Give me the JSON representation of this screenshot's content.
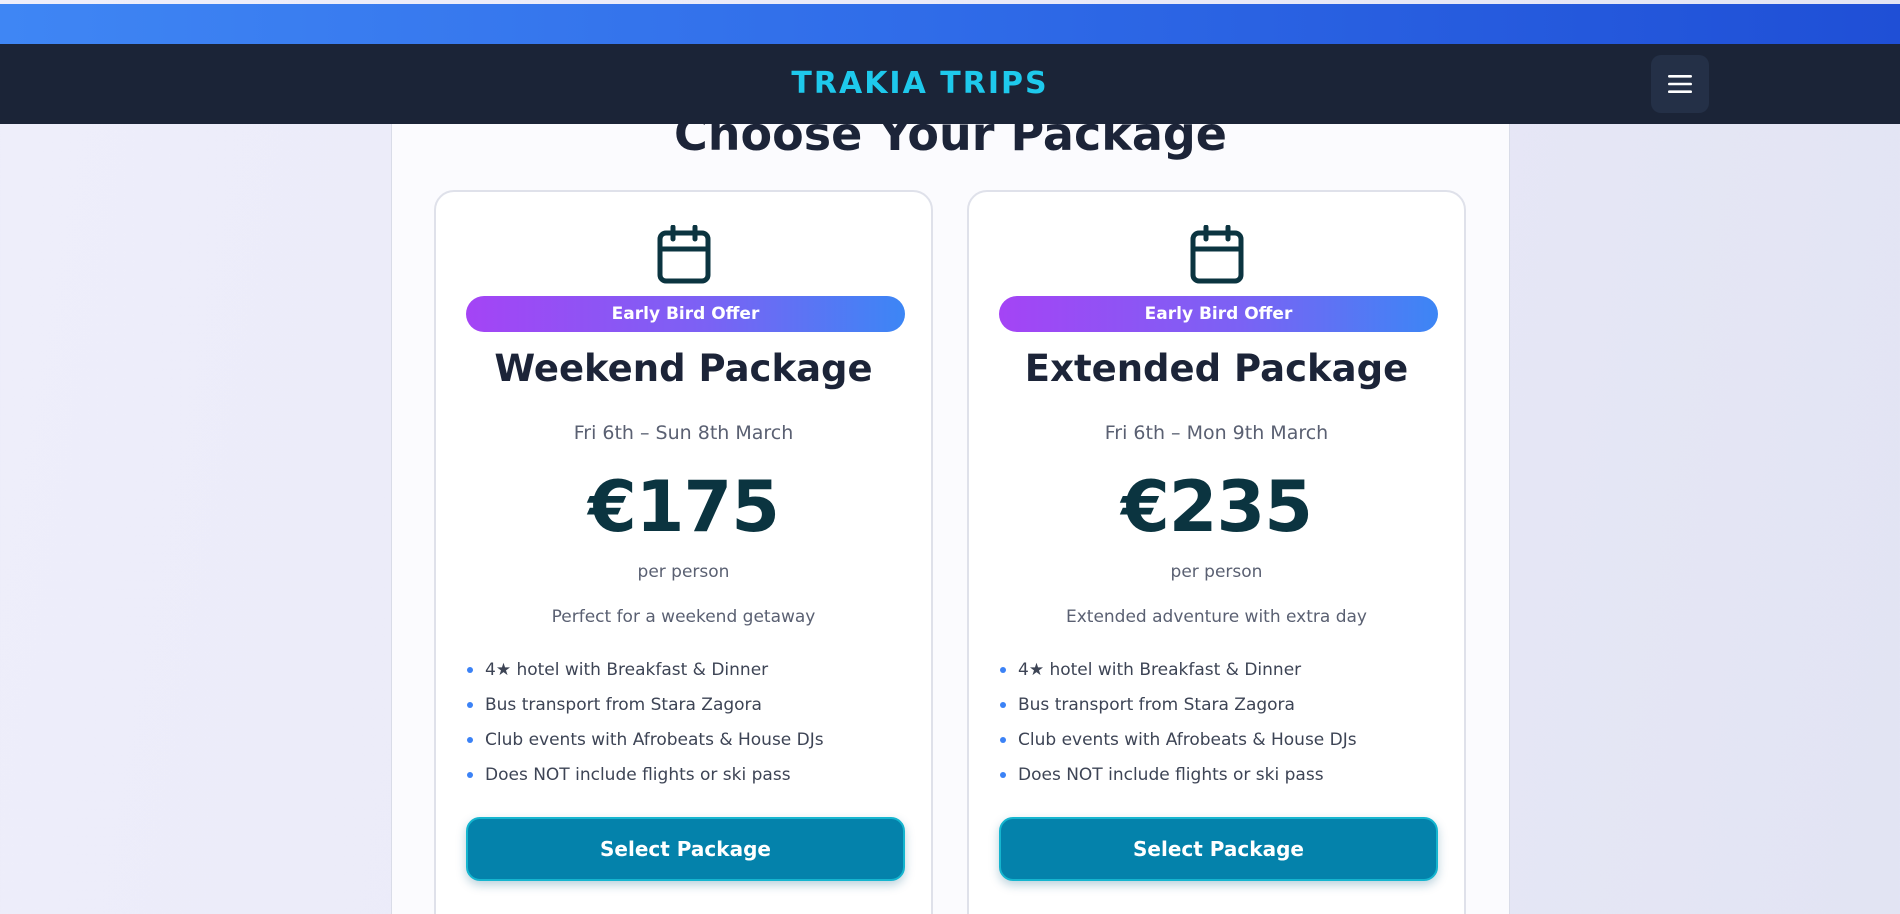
{
  "brand": {
    "name": "TRAKIA TRIPS"
  },
  "menu": {
    "icon": "hamburger-menu-icon"
  },
  "section": {
    "title": "Choose Your Package"
  },
  "colors": {
    "brand_accent": "#1ec9ec",
    "nav_background": "#1b2437",
    "badge_gradient_start": "#a444f5",
    "badge_gradient_end": "#3c86f5",
    "price_text": "#0b3440",
    "button_background": "#0482ab",
    "bullet": "#3b82f6"
  },
  "packages": [
    {
      "icon": "calendar-icon",
      "badge": "Early Bird Offer",
      "title": "Weekend Package",
      "dates": "Fri 6th – Sun 8th March",
      "price": "€175",
      "price_unit": "per person",
      "tagline": "Perfect for a weekend getaway",
      "features": [
        "4★ hotel with Breakfast & Dinner",
        "Bus transport from Stara Zagora",
        "Club events with Afrobeats & House DJs",
        "Does NOT include flights or ski pass"
      ],
      "button": "Select Package"
    },
    {
      "icon": "calendar-icon",
      "badge": "Early Bird Offer",
      "title": "Extended Package",
      "dates": "Fri 6th – Mon 9th March",
      "price": "€235",
      "price_unit": "per person",
      "tagline": "Extended adventure with extra day",
      "features": [
        "4★ hotel with Breakfast & Dinner",
        "Bus transport from Stara Zagora",
        "Club events with Afrobeats & House DJs",
        "Does NOT include flights or ski pass"
      ],
      "button": "Select Package"
    }
  ]
}
